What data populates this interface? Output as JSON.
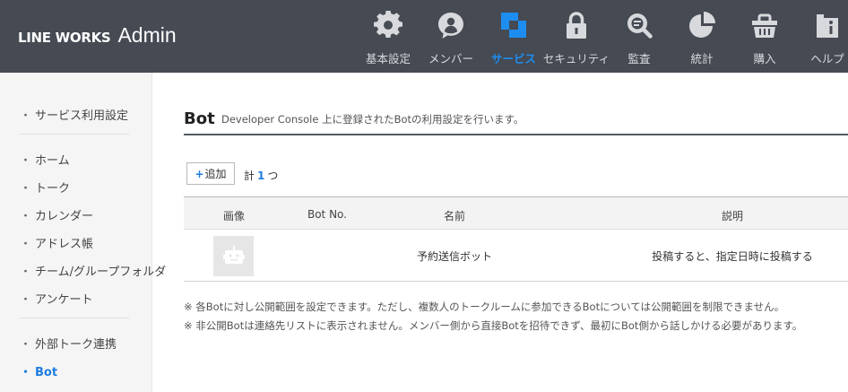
{
  "header": {
    "logo_brand": "LINE WORKS",
    "logo_admin": "Admin",
    "nav": [
      {
        "label": "基本設定",
        "icon": "gear-icon",
        "active": false
      },
      {
        "label": "メンバー",
        "icon": "member-icon",
        "active": false
      },
      {
        "label": "サービス",
        "icon": "service-icon",
        "active": true
      },
      {
        "label": "セキュリティ",
        "icon": "lock-icon",
        "active": false
      },
      {
        "label": "監査",
        "icon": "audit-search-icon",
        "active": false
      },
      {
        "label": "統計",
        "icon": "pie-chart-icon",
        "active": false
      },
      {
        "label": "購入",
        "icon": "shopping-basket-icon",
        "active": false
      },
      {
        "label": "ヘルプ",
        "icon": "help-info-icon",
        "active": false
      }
    ]
  },
  "sidebar": {
    "items": [
      {
        "label": "サービス利用設定",
        "active": false
      },
      {
        "label": "ホーム",
        "active": false
      },
      {
        "label": "トーク",
        "active": false
      },
      {
        "label": "カレンダー",
        "active": false
      },
      {
        "label": "アドレス帳",
        "active": false
      },
      {
        "label": "チーム/グループフォルダ",
        "active": false
      },
      {
        "label": "アンケート",
        "active": false
      },
      {
        "label": "外部トーク連携",
        "active": false
      },
      {
        "label": "Bot",
        "active": true
      }
    ],
    "bullet": "・"
  },
  "main": {
    "title": "Bot",
    "description": "Developer Console 上に登録されたBotの利用設定を行います。",
    "add_button_plus": "+",
    "add_button_label": "追加",
    "count_prefix": "計",
    "count_value": "1",
    "count_suffix": "つ",
    "table": {
      "columns": [
        "画像",
        "Bot No.",
        "名前",
        "説明"
      ],
      "rows": [
        {
          "bot_no": "",
          "name": "予約送信ボット",
          "description": "投稿すると、指定日時に投稿する"
        }
      ]
    },
    "notes": [
      "※ 各Botに対し公開範囲を設定できます。ただし、複数人のトークルームに参加できるBotについては公開範囲を制限できません。",
      "※ 非公開Botは連絡先リストに表示されません。メンバー側から直接Botを招待できず、最初にBot側から話しかける必要があります。"
    ]
  },
  "colors": {
    "header_bg": "#454a53",
    "accent": "#1d7ee0",
    "sidebar_bg": "#f5f5f5"
  }
}
